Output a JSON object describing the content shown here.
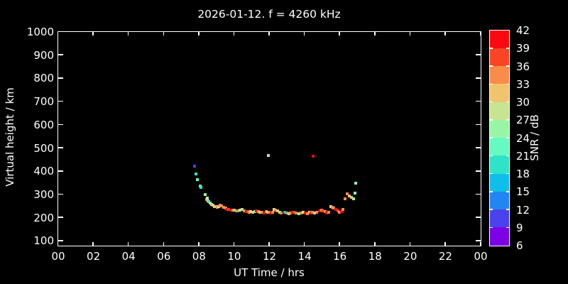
{
  "title": "2026-01-12. f = 4260 kHz",
  "chart_data": {
    "type": "scatter",
    "title": "2026-01-12. f = 4260 kHz",
    "xlabel": "UT Time / hrs",
    "ylabel": "Virtual height / km",
    "xlim": [
      0,
      24
    ],
    "ylim": [
      80,
      1000
    ],
    "grid": false,
    "background": "#000000",
    "frame_color": "#ffffff",
    "text_color": "#ffffff",
    "marker": "square",
    "marker_size_px": 4,
    "x_ticks": {
      "values": [
        0,
        2,
        4,
        6,
        8,
        10,
        12,
        14,
        16,
        18,
        20,
        22,
        24
      ],
      "labels": [
        "00",
        "02",
        "04",
        "06",
        "08",
        "10",
        "12",
        "14",
        "16",
        "18",
        "20",
        "22",
        "00"
      ]
    },
    "y_ticks": [
      100,
      200,
      300,
      400,
      500,
      600,
      700,
      800,
      900,
      1000
    ],
    "colorbar": {
      "label": "SNR / dB",
      "vmin": 6,
      "vmax": 42,
      "step": 3,
      "ticks": [
        6,
        9,
        12,
        15,
        18,
        21,
        24,
        27,
        30,
        33,
        36,
        39,
        42
      ],
      "colors": [
        "#7B00E6",
        "#4B42EE",
        "#2286F2",
        "#0FBFE9",
        "#2FE3C8",
        "#66F9C2",
        "#98F5A6",
        "#C6E492",
        "#F0C46E",
        "#FA8C4A",
        "#FA4426",
        "#FA0A10"
      ]
    },
    "points_format": [
      "ut_hours",
      "virtual_height_km",
      "snr_db"
    ],
    "points": [
      [
        7.76,
        421,
        10
      ],
      [
        7.84,
        386,
        19
      ],
      [
        7.92,
        364,
        23
      ],
      [
        8.08,
        334,
        22
      ],
      [
        8.12,
        330,
        19
      ],
      [
        8.36,
        298,
        25
      ],
      [
        8.45,
        276,
        34
      ],
      [
        8.5,
        282,
        28
      ],
      [
        8.55,
        272,
        28
      ],
      [
        8.58,
        268,
        19
      ],
      [
        8.67,
        263,
        25
      ],
      [
        8.75,
        257,
        28
      ],
      [
        8.83,
        254,
        31
      ],
      [
        8.91,
        248,
        25
      ],
      [
        8.99,
        248,
        31
      ],
      [
        9.07,
        242,
        34
      ],
      [
        9.15,
        248,
        28
      ],
      [
        9.23,
        254,
        34
      ],
      [
        9.31,
        251,
        34
      ],
      [
        9.43,
        245,
        34
      ],
      [
        9.52,
        239,
        34
      ],
      [
        9.64,
        233,
        40
      ],
      [
        9.72,
        233,
        37
      ],
      [
        9.84,
        230,
        40
      ],
      [
        9.96,
        230,
        34
      ],
      [
        10.04,
        230,
        31
      ],
      [
        10.16,
        227,
        19
      ],
      [
        10.24,
        227,
        34
      ],
      [
        10.36,
        230,
        28
      ],
      [
        10.45,
        233,
        25
      ],
      [
        10.57,
        227,
        34
      ],
      [
        10.69,
        224,
        40
      ],
      [
        10.77,
        224,
        37
      ],
      [
        10.89,
        221,
        34
      ],
      [
        10.97,
        224,
        28
      ],
      [
        11.09,
        221,
        31
      ],
      [
        11.21,
        224,
        25
      ],
      [
        11.29,
        227,
        40
      ],
      [
        11.41,
        224,
        34
      ],
      [
        11.49,
        221,
        31
      ],
      [
        11.61,
        221,
        34
      ],
      [
        11.7,
        218,
        40
      ],
      [
        11.82,
        224,
        34
      ],
      [
        11.9,
        221,
        28
      ],
      [
        11.94,
        468,
        29
      ],
      [
        12.02,
        221,
        34
      ],
      [
        12.14,
        218,
        40
      ],
      [
        12.22,
        221,
        34
      ],
      [
        12.3,
        233,
        28
      ],
      [
        12.38,
        230,
        34
      ],
      [
        12.47,
        227,
        31
      ],
      [
        12.59,
        221,
        25
      ],
      [
        12.67,
        218,
        34
      ],
      [
        12.87,
        221,
        17
      ],
      [
        12.99,
        218,
        34
      ],
      [
        13.11,
        215,
        28
      ],
      [
        13.23,
        218,
        34
      ],
      [
        13.35,
        221,
        40
      ],
      [
        13.43,
        221,
        38
      ],
      [
        13.55,
        218,
        34
      ],
      [
        13.68,
        215,
        25
      ],
      [
        13.8,
        218,
        34
      ],
      [
        13.92,
        221,
        28
      ],
      [
        14.04,
        218,
        40
      ],
      [
        14.16,
        215,
        34
      ],
      [
        14.28,
        221,
        31
      ],
      [
        14.36,
        218,
        40
      ],
      [
        14.48,
        221,
        34
      ],
      [
        14.51,
        464,
        40
      ],
      [
        14.6,
        218,
        28
      ],
      [
        14.72,
        221,
        34
      ],
      [
        14.85,
        227,
        40
      ],
      [
        14.97,
        230,
        34
      ],
      [
        15.05,
        227,
        38
      ],
      [
        15.17,
        224,
        34
      ],
      [
        15.25,
        218,
        40
      ],
      [
        15.37,
        221,
        34
      ],
      [
        15.49,
        248,
        28
      ],
      [
        15.57,
        242,
        34
      ],
      [
        15.69,
        239,
        34
      ],
      [
        15.78,
        233,
        40
      ],
      [
        15.9,
        227,
        38
      ],
      [
        15.98,
        221,
        34
      ],
      [
        16.1,
        224,
        40
      ],
      [
        16.18,
        233,
        34
      ],
      [
        16.3,
        279,
        34
      ],
      [
        16.42,
        303,
        34
      ],
      [
        16.54,
        291,
        31
      ],
      [
        16.66,
        285,
        31
      ],
      [
        16.78,
        279,
        25
      ],
      [
        16.9,
        306,
        25
      ],
      [
        16.94,
        346,
        24
      ]
    ]
  }
}
